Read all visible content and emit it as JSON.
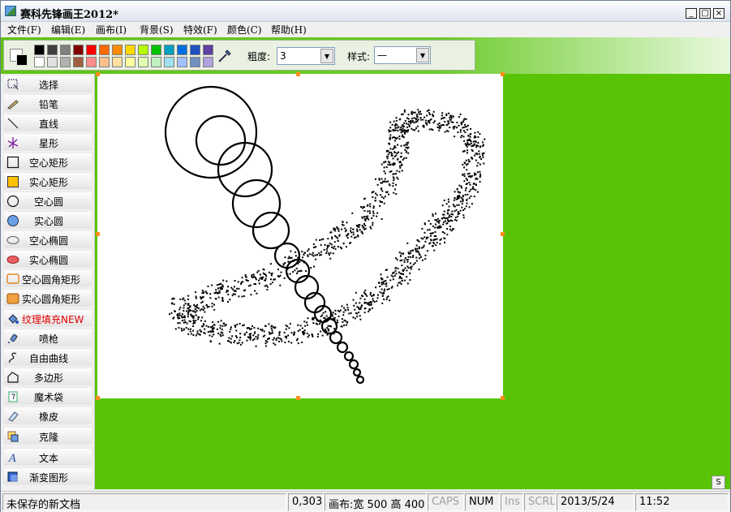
{
  "window": {
    "title": "赛科先锋画王2012*",
    "controls": {
      "minimize": "_",
      "maximize": "□",
      "close": "×"
    }
  },
  "menu": [
    "文件(F)",
    "编辑(E)",
    "画布(I)",
    "背景(S)",
    "特效(F)",
    "颜色(C)",
    "帮助(H)"
  ],
  "toolbar": {
    "thickness_label": "粗度:",
    "thickness_value": "3",
    "style_label": "样式:",
    "style_value": "—",
    "palette": [
      "#000000",
      "#404040",
      "#808080",
      "#800000",
      "#ff0000",
      "#ff6a00",
      "#ff8c00",
      "#ffd800",
      "#b6ff00",
      "#00c000",
      "#00a0c0",
      "#0070e0",
      "#2050c0",
      "#6040a0",
      "#ffffff",
      "#e0e0e0",
      "#b0b0b0",
      "#a06040",
      "#ff8c8c",
      "#ffc090",
      "#ffe0a0",
      "#ffffa0",
      "#e0ffb0",
      "#c0f0c0",
      "#a0e0f0",
      "#a0c0ff",
      "#7090c0",
      "#b0a0e0"
    ]
  },
  "tools": [
    {
      "label": "选择",
      "icon": "select-icon"
    },
    {
      "label": "铅笔",
      "icon": "pencil-icon"
    },
    {
      "label": "直线",
      "icon": "line-icon"
    },
    {
      "label": "星形",
      "icon": "star-icon"
    },
    {
      "label": "空心矩形",
      "icon": "hollow-rect-icon"
    },
    {
      "label": "实心矩形",
      "icon": "solid-rect-icon"
    },
    {
      "label": "空心圆",
      "icon": "hollow-circle-icon"
    },
    {
      "label": "实心圆",
      "icon": "solid-circle-icon"
    },
    {
      "label": "空心椭圆",
      "icon": "hollow-ellipse-icon"
    },
    {
      "label": "实心椭圆",
      "icon": "solid-ellipse-icon"
    },
    {
      "label": "空心圆角矩形",
      "icon": "hollow-rounded-rect-icon"
    },
    {
      "label": "实心圆角矩形",
      "icon": "solid-rounded-rect-icon"
    },
    {
      "label": "纹理填充NEW",
      "icon": "texture-fill-icon"
    },
    {
      "label": "喷枪",
      "icon": "spray-icon"
    },
    {
      "label": "自由曲线",
      "icon": "free-curve-icon"
    },
    {
      "label": "多边形",
      "icon": "polygon-icon"
    },
    {
      "label": "魔术袋",
      "icon": "magic-bag-icon"
    },
    {
      "label": "橡皮",
      "icon": "eraser-icon"
    },
    {
      "label": "克隆",
      "icon": "clone-icon"
    },
    {
      "label": "文本",
      "icon": "text-icon"
    },
    {
      "label": "渐变图形",
      "icon": "gradient-shape-icon"
    }
  ],
  "colors": {
    "workspace": "#59c406",
    "handle": "#ff8c1a",
    "accent_red": "#e00000"
  },
  "scroll_corner": "S",
  "status": {
    "document": "未保存的新文档",
    "coords": "0,303",
    "canvas_size": "画布:宽 500 高 400",
    "caps": "CAPS",
    "num": "NUM",
    "ins": "Ins",
    "scrl": "SCRL",
    "date": "2013/5/24",
    "time": "11:52"
  }
}
